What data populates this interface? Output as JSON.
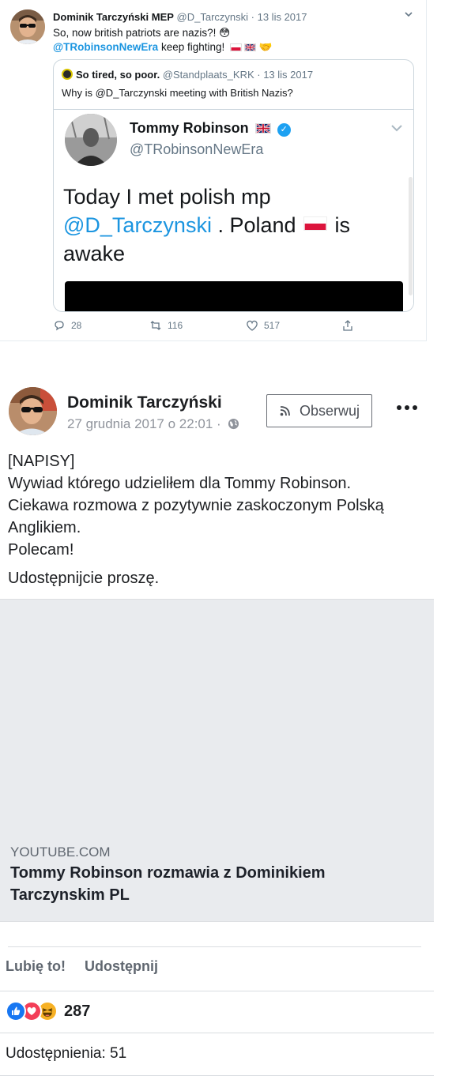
{
  "tweet": {
    "author_name": "Dominik Tarczyński MEP",
    "author_handle": "@D_Tarczynski",
    "separator": " · ",
    "date": "13 lis 2017",
    "text_line1": "So, now british patriots are nazis?!",
    "mention": "@TRobinsonNewEra",
    "text_line2_rest": " keep fighting!",
    "emoji_flushed": "😳",
    "emoji_handshake": "🤝",
    "quoted": {
      "author_name": "So tired, so poor.",
      "author_handle": "@Standplaats_KRK",
      "date": "13 lis 2017",
      "text": "Why is @D_Tarczynski meeting with British Nazis?",
      "screenshot": {
        "name": "Tommy Robinson",
        "handle": "@TRobinsonNewEra",
        "text_start": "Today I met polish mp",
        "mention": "@D_Tarczynski",
        "text_mid": " .  Poland ",
        "text_end": " is awake"
      }
    },
    "actions": {
      "replies": "28",
      "retweets": "116",
      "likes": "517"
    }
  },
  "fb_post": {
    "author_name": "Dominik Tarczyński",
    "timestamp": "27 grudnia 2017 o 22:01",
    "timestamp_sep": " · ",
    "follow_label": "Obserwuj",
    "body_lines": [
      "[NAPISY]",
      "Wywiad którego udzieliłem dla Tommy Robinson.",
      "Ciekawa rozmowa z pozytywnie zaskoczonym Polską Anglikiem.",
      "Polecam!"
    ],
    "body_extra": "Udostępnijcie proszę.",
    "link": {
      "source": "YOUTUBE.COM",
      "title": "Tommy Robinson rozmawia z Dominikiem Tarczynskim PL"
    },
    "like_label": "Lubię to!",
    "share_label": "Udostępnij",
    "reactions_count": "287",
    "shares_text": "Udostępnienia: 51"
  },
  "colors": {
    "twitter_blue": "#1b95e0",
    "fb_blue": "#1877f2",
    "fb_gray": "#606770"
  }
}
